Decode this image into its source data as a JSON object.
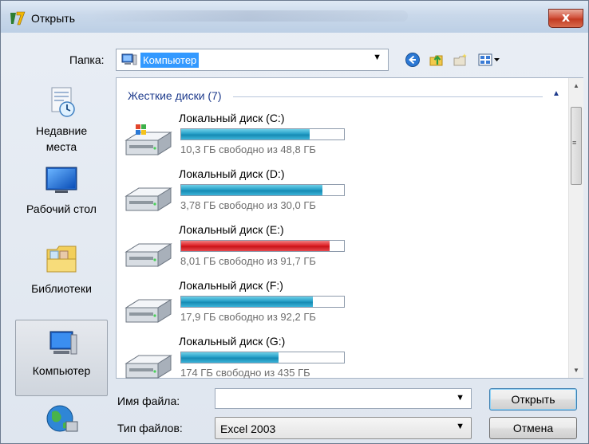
{
  "window": {
    "title": "Открыть",
    "close_label": "x"
  },
  "toolbar": {
    "folder_label": "Папка:",
    "folder_value": "Компьютер",
    "icons": [
      "back-icon",
      "up-folder-icon",
      "new-folder-icon",
      "view-menu-icon"
    ]
  },
  "sidebar": {
    "items": [
      {
        "label_line1": "Недавние",
        "label_line2": "места",
        "icon": "recent-places-icon"
      },
      {
        "label_line1": "Рабочий стол",
        "label_line2": "",
        "icon": "desktop-icon"
      },
      {
        "label_line1": "Библиотеки",
        "label_line2": "",
        "icon": "libraries-icon"
      },
      {
        "label_line1": "Компьютер",
        "label_line2": "",
        "icon": "computer-icon",
        "active": true
      },
      {
        "label_line1": "",
        "label_line2": "",
        "icon": "network-icon"
      }
    ]
  },
  "list": {
    "group_header": "Жесткие диски (7)",
    "drives": [
      {
        "name": "Локальный диск (C:)",
        "free_text": "10,3 ГБ свободно из 48,8 ГБ",
        "used_fraction": 0.79,
        "status": "normal",
        "os_drive": true
      },
      {
        "name": "Локальный диск (D:)",
        "free_text": "3,78 ГБ свободно из 30,0 ГБ",
        "used_fraction": 0.87,
        "status": "normal",
        "os_drive": false
      },
      {
        "name": "Локальный диск (E:)",
        "free_text": "8,01 ГБ свободно из 91,7 ГБ",
        "used_fraction": 0.91,
        "status": "full",
        "os_drive": false
      },
      {
        "name": "Локальный диск (F:)",
        "free_text": "17,9 ГБ свободно из 92,2 ГБ",
        "used_fraction": 0.81,
        "status": "normal",
        "os_drive": false
      },
      {
        "name": "Локальный диск (G:)",
        "free_text": "174 ГБ свободно из 435 ГБ",
        "used_fraction": 0.6,
        "status": "normal",
        "os_drive": false
      }
    ]
  },
  "bottom": {
    "filename_label": "Имя файла:",
    "filename_value": "",
    "filetype_label": "Тип файлов:",
    "filetype_value": "Excel 2003",
    "open_button": "Открыть",
    "cancel_button": "Отмена"
  },
  "colors": {
    "selection": "#3399ff",
    "bar_normal": "#26a0da",
    "bar_full": "#da2626",
    "group_header": "#1e3b8c"
  }
}
